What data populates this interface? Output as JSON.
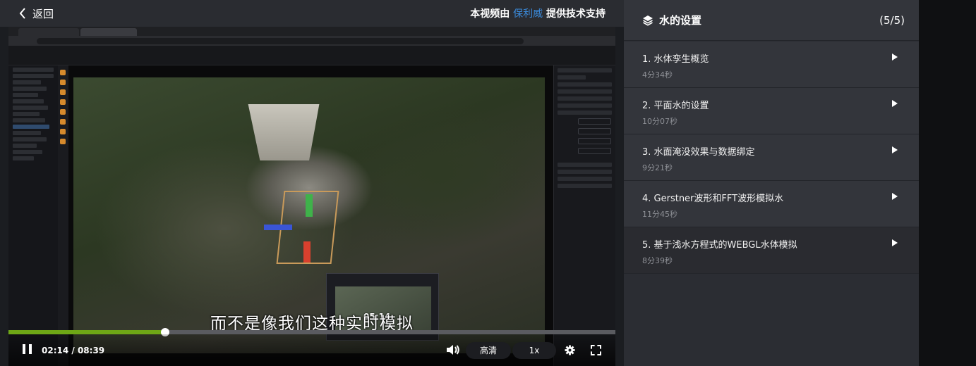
{
  "header": {
    "back_label": "返回",
    "sponsor_prefix": "本视频由",
    "sponsor_name": "保利威",
    "sponsor_suffix": "提供技术支持"
  },
  "player": {
    "subtitle": "而不是像我们这种实时模拟",
    "hover_time": "05:14",
    "current_time": "02:14",
    "separator": " / ",
    "duration": "08:39",
    "progress_fraction": 0.258,
    "quality_label": "高清",
    "speed_label": "1x",
    "colors": {
      "progress": "#6ea616",
      "accent_link": "#3b8bdc"
    }
  },
  "playlist": {
    "title": "水的设置",
    "count": "(5/5)",
    "items": [
      {
        "title": "1. 水体孪生概览",
        "duration": "4分34秒"
      },
      {
        "title": "2. 平面水的设置",
        "duration": "10分07秒"
      },
      {
        "title": "3. 水面淹没效果与数据绑定",
        "duration": "9分21秒"
      },
      {
        "title": "4. Gerstner波形和FFT波形模拟水",
        "duration": "11分45秒"
      },
      {
        "title": "5. 基于浅水方程式的WEBGL水体模拟",
        "duration": "8分39秒"
      }
    ]
  },
  "icons": [
    "back-chevron-icon",
    "layers-icon",
    "play-triangle-icon",
    "pause-icon",
    "volume-icon",
    "gear-icon",
    "fullscreen-icon"
  ]
}
